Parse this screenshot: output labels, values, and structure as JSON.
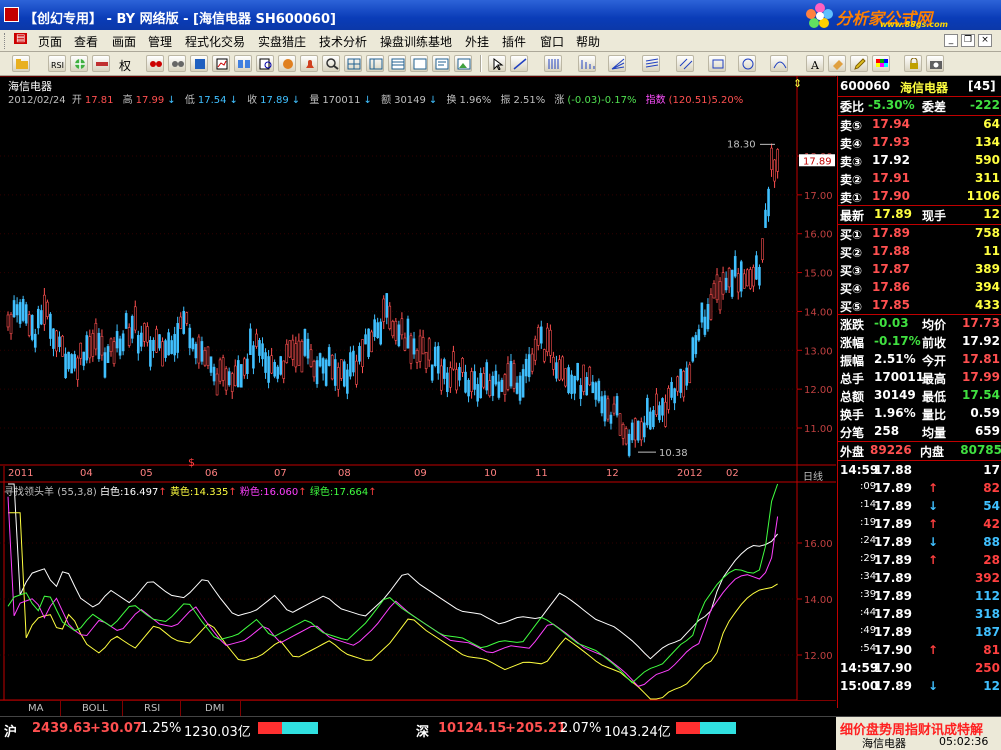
{
  "window": {
    "title": "【创幻专用】 - BY 网络版 - [海信电器 SH600060]",
    "brand": "分析家公式网",
    "brand_url": "www.88gs.com",
    "min_label": "_",
    "max_label": "□",
    "close_label": "×"
  },
  "menu": [
    "页面",
    "查看",
    "画面",
    "管理",
    "程式化交易",
    "实盘猎庄",
    "技术分析",
    "操盘训练基地",
    "外挂",
    "插件",
    "窗口",
    "帮助"
  ],
  "toolbar": {
    "quan_label": "权"
  },
  "chart": {
    "stock_name": "海信电器",
    "date": "2012/02/24",
    "open_label": "开",
    "open": "17.81",
    "high_label": "高",
    "high": "17.99",
    "low_label": "低",
    "low": "17.54",
    "close_label": "收",
    "close": "17.89",
    "volume_label": "量",
    "volume": "170011",
    "amount_label": "额",
    "amount": "30149",
    "turnover_label": "换",
    "turnover": "1.96%",
    "amplitude_label": "振",
    "amplitude": "2.51%",
    "change_label": "涨",
    "change": "(-0.03)-0.17%",
    "index_label": "指数",
    "index": "(120.51)5.20%",
    "max_mark": "18.30",
    "min_mark": "10.38",
    "current_price_tag": "17.89",
    "period": "日线",
    "date_labels": [
      "2011",
      "04",
      "05",
      "06",
      "07",
      "08",
      "09",
      "10",
      "11",
      "12",
      "2012",
      "02"
    ],
    "dollar_mark": "$"
  },
  "indicator": {
    "name": "寻找领头羊",
    "params": "(55,3,8)",
    "white_label": "白色:",
    "white_val": "16.497",
    "yellow_label": "黄色:",
    "yellow_val": "14.335",
    "pink_label": "粉色:",
    "pink_val": "16.060",
    "green_label": "绿色:",
    "green_val": "17.664"
  },
  "chart_data": {
    "type": "candlestick",
    "price_axis_ticks": [
      "18.00",
      "17.00",
      "16.00",
      "15.00",
      "14.00",
      "13.00",
      "12.00",
      "11.00"
    ],
    "indicator_axis_ticks": [
      "16.00",
      "14.00",
      "12.00"
    ],
    "price_range": [
      10.38,
      18.3
    ],
    "indicator_range": [
      11.3,
      17.7
    ]
  },
  "tabs": [
    "MA",
    "BOLL",
    "RSI",
    "DMI"
  ],
  "quote": {
    "code": "600060",
    "name": "海信电器",
    "suffix": "[45]",
    "weibi_label": "委比",
    "weibi": "-5.30%",
    "weicha_label": "委差",
    "weicha": "-222",
    "sells": [
      {
        "label": "卖⑤",
        "price": "17.94",
        "vol": "64"
      },
      {
        "label": "卖④",
        "price": "17.93",
        "vol": "134"
      },
      {
        "label": "卖③",
        "price": "17.92",
        "vol": "590"
      },
      {
        "label": "卖②",
        "price": "17.91",
        "vol": "311"
      },
      {
        "label": "卖①",
        "price": "17.90",
        "vol": "1106"
      }
    ],
    "latest_label": "最新",
    "latest": "17.89",
    "xianshou_label": "现手",
    "xianshou": "12",
    "buys": [
      {
        "label": "买①",
        "price": "17.89",
        "vol": "758"
      },
      {
        "label": "买②",
        "price": "17.88",
        "vol": "11"
      },
      {
        "label": "买③",
        "price": "17.87",
        "vol": "389"
      },
      {
        "label": "买④",
        "price": "17.86",
        "vol": "394"
      },
      {
        "label": "买⑤",
        "price": "17.85",
        "vol": "433"
      }
    ],
    "stats": [
      {
        "l1": "涨跌",
        "v1": "-0.03",
        "l2": "均价",
        "v2": "17.73"
      },
      {
        "l1": "涨幅",
        "v1": "-0.17%",
        "l2": "前收",
        "v2": "17.92"
      },
      {
        "l1": "振幅",
        "v1": "2.51%",
        "l2": "今开",
        "v2": "17.81"
      },
      {
        "l1": "总手",
        "v1": "170011",
        "l2": "最高",
        "v2": "17.99"
      },
      {
        "l1": "总额",
        "v1": "30149",
        "l2": "最低",
        "v2": "17.54"
      },
      {
        "l1": "换手",
        "v1": "1.96%",
        "l2": "量比",
        "v2": "0.59"
      },
      {
        "l1": "分笔",
        "v1": "258",
        "l2": "均量",
        "v2": "659"
      }
    ],
    "waipan_label": "外盘",
    "waipan": "89226",
    "neipan_label": "内盘",
    "neipan": "80785",
    "ticks": [
      {
        "t": "14:59",
        "p": "17.88",
        "a": "",
        "v": "17",
        "c": "#fff"
      },
      {
        "t": ":09",
        "p": "17.89",
        "a": "↑",
        "v": "82",
        "c": "#ff4040"
      },
      {
        "t": ":14",
        "p": "17.89",
        "a": "↓",
        "v": "54",
        "c": "#40c0ff"
      },
      {
        "t": ":19",
        "p": "17.89",
        "a": "↑",
        "v": "42",
        "c": "#ff4040"
      },
      {
        "t": ":24",
        "p": "17.89",
        "a": "↓",
        "v": "88",
        "c": "#40c0ff"
      },
      {
        "t": ":29",
        "p": "17.89",
        "a": "↑",
        "v": "28",
        "c": "#ff4040"
      },
      {
        "t": ":34",
        "p": "17.89",
        "a": "",
        "v": "392",
        "c": "#ff4040"
      },
      {
        "t": ":39",
        "p": "17.89",
        "a": "",
        "v": "112",
        "c": "#40c0ff"
      },
      {
        "t": ":44",
        "p": "17.89",
        "a": "",
        "v": "318",
        "c": "#40c0ff"
      },
      {
        "t": ":49",
        "p": "17.89",
        "a": "",
        "v": "187",
        "c": "#40c0ff"
      },
      {
        "t": ":54",
        "p": "17.90",
        "a": "↑",
        "v": "81",
        "c": "#ff4040"
      },
      {
        "t": "14:59",
        "p": "17.90",
        "a": "",
        "v": "250",
        "c": "#ff4040"
      },
      {
        "t": "15:00",
        "p": "17.89",
        "a": "↓",
        "v": "12",
        "c": "#40c0ff"
      }
    ],
    "ticker_text": "细价盘势周指财讯成特解"
  },
  "status": {
    "sh_label": "沪",
    "sh_index": "2439.63",
    "sh_chg": "+30.07",
    "sh_pct": "1.25%",
    "sh_amt": "1230.03亿",
    "sz_label": "深",
    "sz_index": "10124.15",
    "sz_chg": "+205.21",
    "sz_pct": "2.07%",
    "sz_amt": "1043.24亿",
    "stock": "海信电器",
    "time": "05:02:36"
  },
  "colors": {
    "up": "#ff5050",
    "down": "#40c0ff",
    "axis": "#c00000"
  }
}
